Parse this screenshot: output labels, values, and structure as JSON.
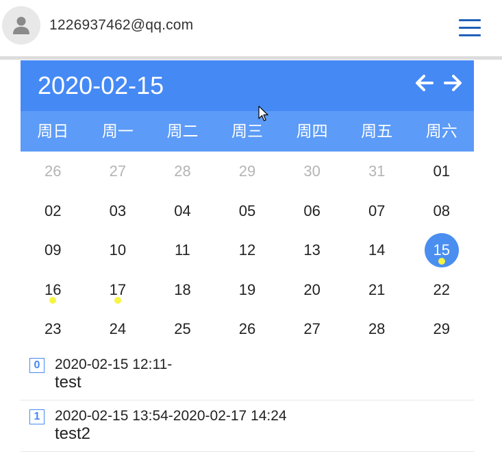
{
  "user": {
    "email": "1226937462@qq.com",
    "avatar_icon": "person-icon"
  },
  "menu": {
    "icon": "hamburger-menu-icon"
  },
  "calendar": {
    "current_date": "2020-02-15",
    "nav": {
      "prev_icon": "arrow-left-icon",
      "next_icon": "arrow-right-icon"
    },
    "weekdays": [
      "周日",
      "周一",
      "周二",
      "周三",
      "周四",
      "周五",
      "周六"
    ],
    "weeks": [
      [
        {
          "d": "26",
          "other": true
        },
        {
          "d": "27",
          "other": true
        },
        {
          "d": "28",
          "other": true
        },
        {
          "d": "29",
          "other": true
        },
        {
          "d": "30",
          "other": true
        },
        {
          "d": "31",
          "other": true
        },
        {
          "d": "01"
        }
      ],
      [
        {
          "d": "02"
        },
        {
          "d": "03"
        },
        {
          "d": "04"
        },
        {
          "d": "05"
        },
        {
          "d": "06"
        },
        {
          "d": "07"
        },
        {
          "d": "08"
        }
      ],
      [
        {
          "d": "09"
        },
        {
          "d": "10"
        },
        {
          "d": "11"
        },
        {
          "d": "12"
        },
        {
          "d": "13"
        },
        {
          "d": "14"
        },
        {
          "d": "15",
          "selected": true,
          "event": true
        }
      ],
      [
        {
          "d": "16",
          "event": true
        },
        {
          "d": "17",
          "event": true
        },
        {
          "d": "18"
        },
        {
          "d": "19"
        },
        {
          "d": "20"
        },
        {
          "d": "21"
        },
        {
          "d": "22"
        }
      ],
      [
        {
          "d": "23"
        },
        {
          "d": "24"
        },
        {
          "d": "25"
        },
        {
          "d": "26"
        },
        {
          "d": "27"
        },
        {
          "d": "28"
        },
        {
          "d": "29"
        }
      ]
    ],
    "colors": {
      "header": "#4589f5",
      "weekday_bar": "#5c9bf7",
      "selected": "#4a8ff0",
      "event_dot": "#f5f542"
    }
  },
  "events": [
    {
      "index": "0",
      "time": "2020-02-15 12:11-",
      "title": "test"
    },
    {
      "index": "1",
      "time": "2020-02-15 13:54-2020-02-17 14:24",
      "title": "test2"
    }
  ]
}
